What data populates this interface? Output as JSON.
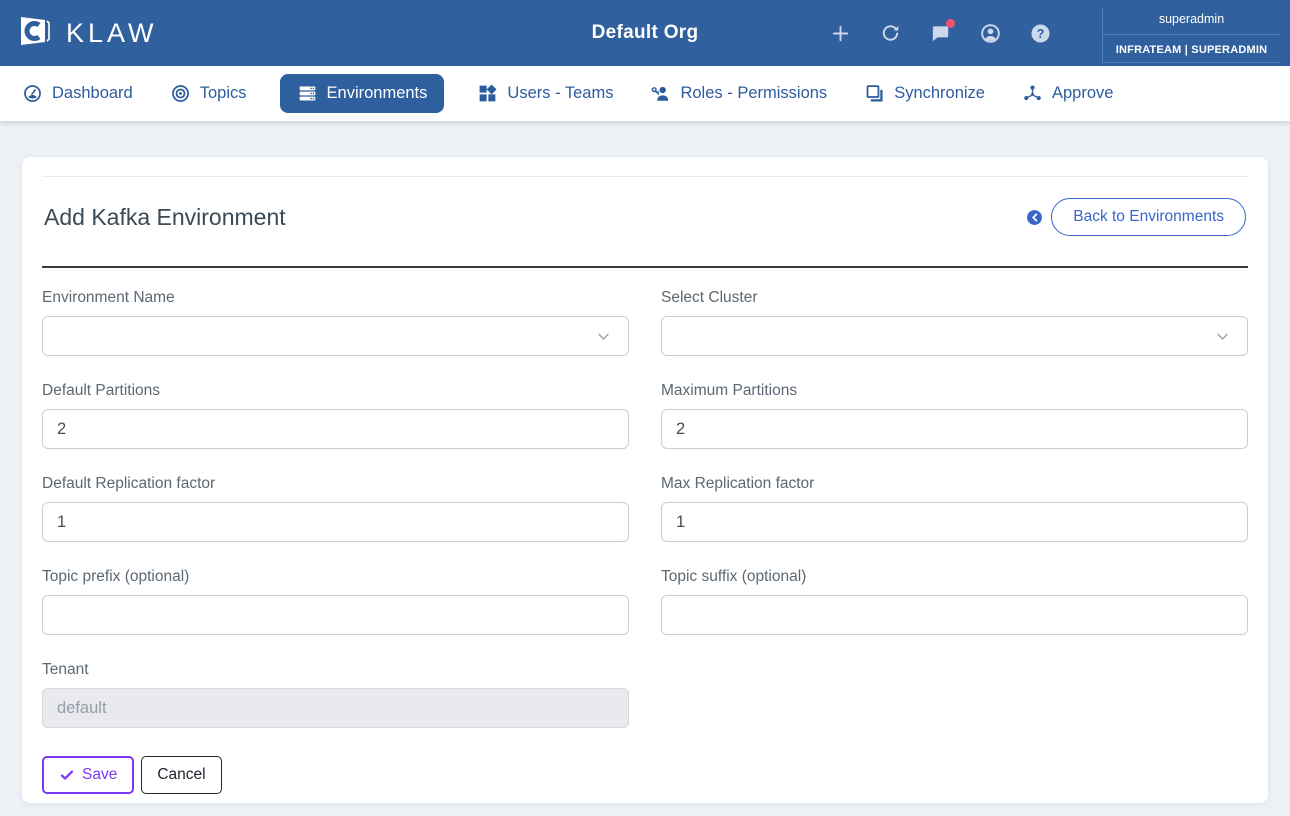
{
  "navbar": {
    "brand": "KLAW",
    "org_title": "Default Org",
    "icons": [
      "plus",
      "refresh",
      "chat-notification",
      "account",
      "help"
    ],
    "user": {
      "name": "superadmin",
      "team_role": "INFRATEAM | SUPERADMIN"
    }
  },
  "nav_tabs": {
    "items": [
      {
        "label": "Dashboard",
        "icon": "dashboard-gauge",
        "active": false
      },
      {
        "label": "Topics",
        "icon": "target",
        "active": false
      },
      {
        "label": "Environments",
        "icon": "server-stack",
        "active": true
      },
      {
        "label": "Users - Teams",
        "icon": "widgets",
        "active": false
      },
      {
        "label": "Roles - Permissions",
        "icon": "person-key",
        "active": false
      },
      {
        "label": "Synchronize",
        "icon": "overlap-squares",
        "active": false
      },
      {
        "label": "Approve",
        "icon": "hub-network",
        "active": false
      }
    ]
  },
  "page": {
    "title": "Add Kafka Environment",
    "back_button_label": "Back to Environments"
  },
  "form": {
    "fields": [
      {
        "label": "Environment Name",
        "type": "select",
        "value": ""
      },
      {
        "label": "Select Cluster",
        "type": "select",
        "value": ""
      },
      {
        "label": "Default Partitions",
        "type": "text",
        "value": "2"
      },
      {
        "label": "Maximum Partitions",
        "type": "text",
        "value": "2"
      },
      {
        "label": "Default Replication factor",
        "type": "text",
        "value": "1"
      },
      {
        "label": "Max Replication factor",
        "type": "text",
        "value": "1"
      },
      {
        "label": "Topic prefix (optional)",
        "type": "text",
        "value": ""
      },
      {
        "label": "Topic suffix (optional)",
        "type": "text",
        "value": ""
      },
      {
        "label": "Tenant",
        "type": "text",
        "value": "default",
        "disabled": true
      }
    ],
    "save_label": "Save",
    "cancel_label": "Cancel"
  },
  "colors": {
    "navbar_blue": "#31609f",
    "tab_link_blue": "#2d5c9e",
    "active_tab_bg": "#2e5f9e",
    "back_button_blue": "#3a66c9",
    "save_purple": "#7c3af2",
    "notification_red": "#f2556a",
    "page_bg": "#edf1f6",
    "title_text": "#3b4a55",
    "label_text": "#5c6873"
  }
}
